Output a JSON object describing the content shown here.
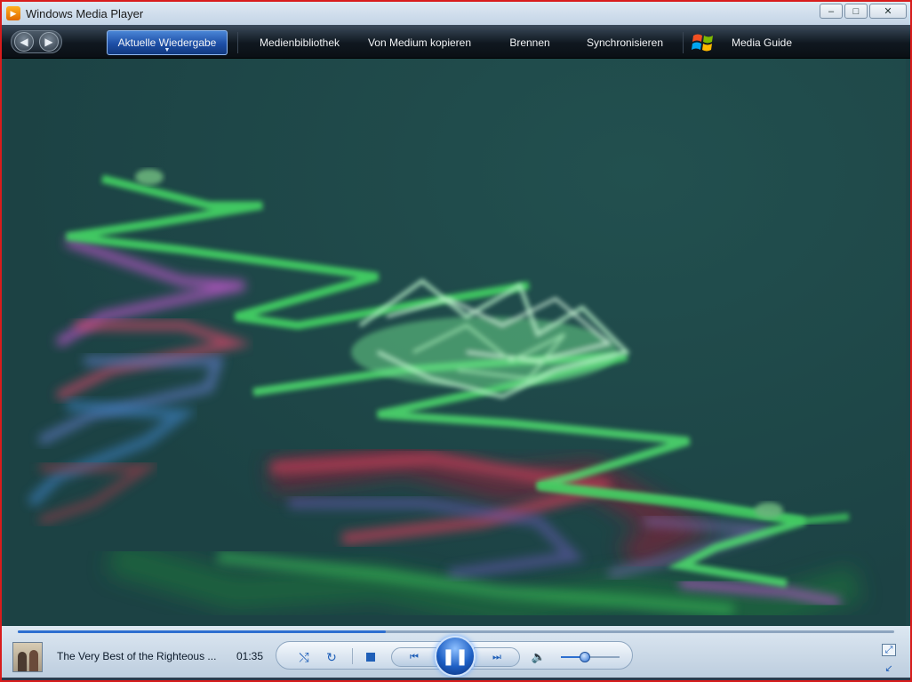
{
  "window": {
    "title": "Windows Media Player",
    "icon": "media-player-icon",
    "controls": {
      "minimize": "–",
      "maximize": "□",
      "close": "✕"
    }
  },
  "nav": {
    "back_icon": "back-arrow-icon",
    "forward_icon": "forward-arrow-icon",
    "tabs": [
      {
        "label": "Aktuelle Wiedergabe",
        "active": true
      },
      {
        "label": "Medienbibliothek",
        "active": false
      },
      {
        "label": "Von Medium kopieren",
        "active": false
      },
      {
        "label": "Brennen",
        "active": false
      },
      {
        "label": "Synchronisieren",
        "active": false
      },
      {
        "label": "Media Guide",
        "active": false
      }
    ],
    "guide_logo": "windows-logo-icon"
  },
  "player": {
    "track_title": "The Very Best of the Righteous ...",
    "elapsed_time": "01:35",
    "seek_progress": 0.42,
    "volume_level": 0.36,
    "state": "playing",
    "icons": {
      "shuffle": "⤭",
      "repeat": "↻",
      "prev": "⏮",
      "play_pause": "❚❚",
      "next": "⏭",
      "volume": "🔈",
      "fullscreen": "⤢",
      "mini_mode": "↙"
    }
  },
  "colors": {
    "viz_background": "#1e4548",
    "accent": "#2d6fd0",
    "window_border": "#d81c1c"
  }
}
